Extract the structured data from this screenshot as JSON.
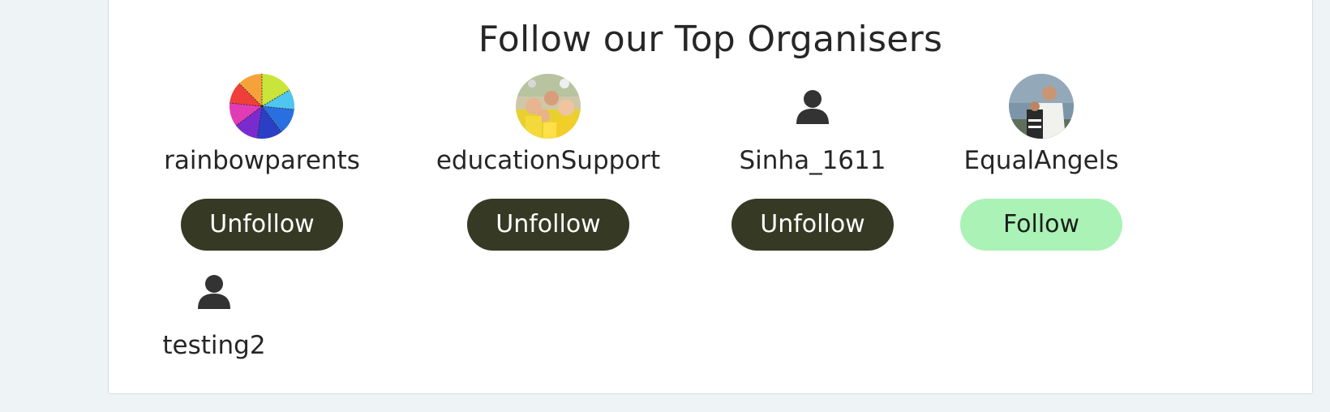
{
  "section": {
    "title": "Follow our Top Organisers"
  },
  "organisers": [
    {
      "username": "rainbowparents",
      "button_label": "Unfollow",
      "following": true,
      "avatar": "rainbow-umbrella-photo"
    },
    {
      "username": "educationSupport",
      "button_label": "Unfollow",
      "following": true,
      "avatar": "group-photo"
    },
    {
      "username": "Sinha_1611",
      "button_label": "Unfollow",
      "following": true,
      "avatar": "default-user-icon"
    },
    {
      "username": "EqualAngels",
      "button_label": "Follow",
      "following": false,
      "avatar": "person-photo"
    },
    {
      "username": "testing2",
      "avatar": "default-user-icon"
    }
  ],
  "colors": {
    "page_background": "#eef3f6",
    "panel_background": "#ffffff",
    "unfollow_button": "#363a24",
    "follow_button": "#aaf2b6",
    "text": "#262626"
  }
}
